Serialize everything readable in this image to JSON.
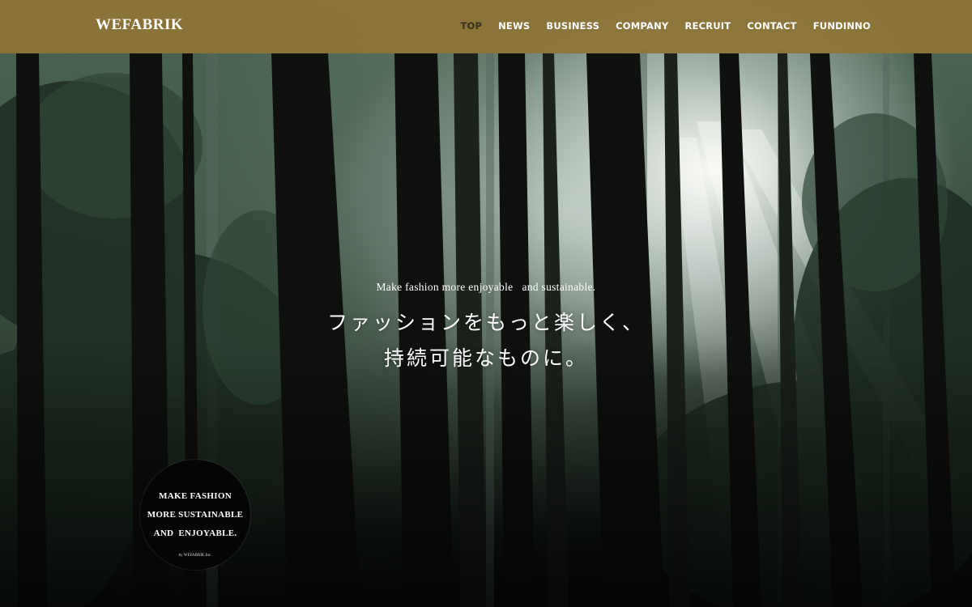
{
  "header": {
    "logo": "WEFABRIK",
    "nav": [
      {
        "label": "TOP",
        "active": true
      },
      {
        "label": "NEWS",
        "active": false
      },
      {
        "label": "BUSINESS",
        "active": false
      },
      {
        "label": "COMPANY",
        "active": false
      },
      {
        "label": "RECRUIT",
        "active": false
      },
      {
        "label": "CONTACT",
        "active": false
      },
      {
        "label": "FUNDINNO",
        "active": false
      }
    ]
  },
  "hero": {
    "tagline": "Make fashion more enjoyable   and sustainable.",
    "headline_line1": "ファッションをもっと楽しく、",
    "headline_line2": "持続可能なものに。"
  },
  "badge": {
    "line1": "MAKE FASHION",
    "line2": "MORE SUSTAINABLE",
    "line3": "AND  ENJOYABLE.",
    "byline": "by WEFABRIK Inc."
  },
  "colors": {
    "header_bg": "#8e7436",
    "nav_active": "#3a3020",
    "text": "#ffffff",
    "badge_bg": "#050505"
  }
}
